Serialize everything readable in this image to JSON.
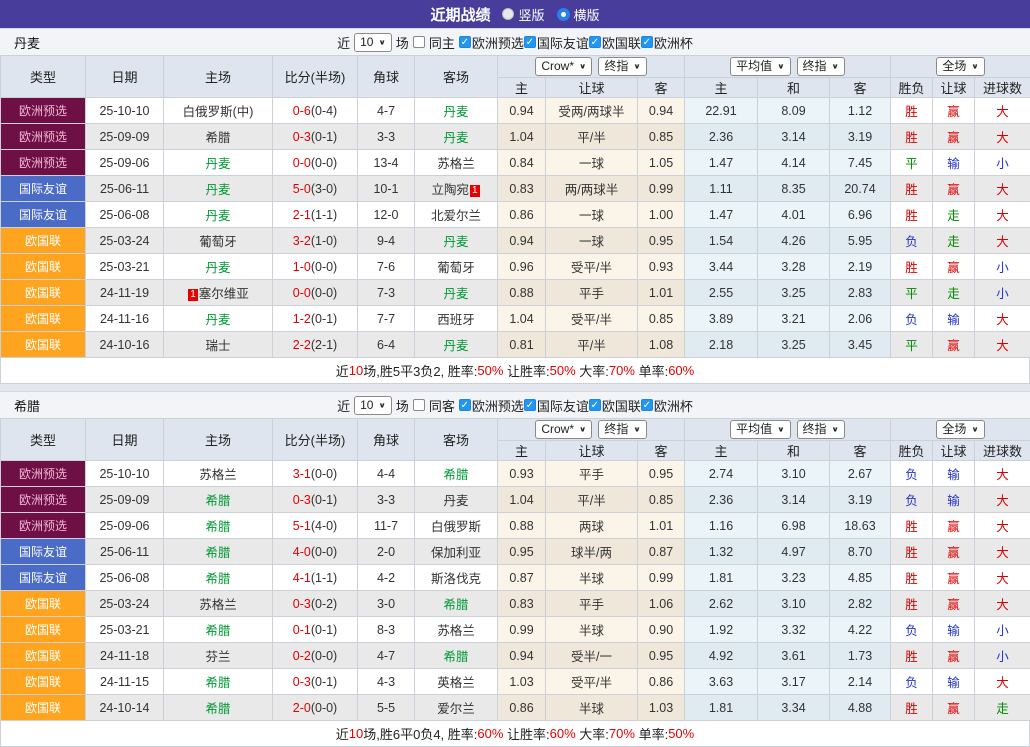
{
  "title_bar": {
    "title": "近期战绩",
    "vertical_label": "竖版",
    "horizontal_label": "横版"
  },
  "filter": {
    "near": "近",
    "count": "10",
    "games": "场"
  },
  "columns": {
    "type": "类型",
    "date": "日期",
    "home": "主场",
    "score": "比分(半场)",
    "corner": "角球",
    "away": "客场",
    "dd_crow": "Crow*",
    "dd_final": "终指",
    "dd_avg": "平均值",
    "dd_full": "全场",
    "h": "主",
    "handicap": "让球",
    "a": "客",
    "avg_h": "主",
    "avg_d": "和",
    "avg_a": "客",
    "wl": "胜负",
    "hc": "让球",
    "goals": "进球数"
  },
  "colors": {
    "accent_purple": "#483d9b",
    "score_red": "#e60000",
    "team_highlight": "#009933",
    "type_badges": {
      "欧洲预选": {
        "bg": "#6e1045",
        "fg": "#f2b7d4"
      },
      "国际友谊": {
        "bg": "#4a6bc6",
        "fg": "#ffffff"
      },
      "欧国联": {
        "bg": "#ffa41f",
        "fg": "#ffffff"
      }
    },
    "outcome": {
      "胜": "#dd0000",
      "平": "#008800",
      "负": "#2233cc",
      "赢": "#dd0000",
      "输": "#2233cc",
      "走": "#008800",
      "大": "#dd0000",
      "小": "#2233cc"
    }
  },
  "sections": [
    {
      "team": "丹麦",
      "same_label": "同主",
      "leagues": [
        "欧洲预选",
        "国际友谊",
        "欧国联",
        "欧洲杯"
      ],
      "rows": [
        {
          "type": "欧洲预选",
          "date": "25-10-10",
          "home": "白俄罗斯(中)",
          "score": "0-6",
          "half": "(0-4)",
          "corner": "4-7",
          "away": "丹麦",
          "odds_h": "0.94",
          "handicap": "受两/两球半",
          "odds_a": "0.94",
          "avg_h": "22.91",
          "avg_d": "8.09",
          "avg_a": "1.12",
          "wl": "胜",
          "hc": "赢",
          "gl": "大"
        },
        {
          "type": "欧洲预选",
          "date": "25-09-09",
          "home": "希腊",
          "score": "0-3",
          "half": "(0-1)",
          "corner": "3-3",
          "away": "丹麦",
          "odds_h": "1.04",
          "handicap": "平/半",
          "odds_a": "0.85",
          "avg_h": "2.36",
          "avg_d": "3.14",
          "avg_a": "3.19",
          "wl": "胜",
          "hc": "赢",
          "gl": "大"
        },
        {
          "type": "欧洲预选",
          "date": "25-09-06",
          "home": "丹麦",
          "score": "0-0",
          "half": "(0-0)",
          "corner": "13-4",
          "away": "苏格兰",
          "odds_h": "0.84",
          "handicap": "一球",
          "odds_a": "1.05",
          "avg_h": "1.47",
          "avg_d": "4.14",
          "avg_a": "7.45",
          "wl": "平",
          "hc": "输",
          "gl": "小"
        },
        {
          "type": "国际友谊",
          "date": "25-06-11",
          "home": "丹麦",
          "score": "5-0",
          "half": "(3-0)",
          "corner": "10-1",
          "away": "立陶宛",
          "away_card": "1",
          "away_card_pos": "after",
          "odds_h": "0.83",
          "handicap": "两/两球半",
          "odds_a": "0.99",
          "avg_h": "1.11",
          "avg_d": "8.35",
          "avg_a": "20.74",
          "wl": "胜",
          "hc": "赢",
          "gl": "大"
        },
        {
          "type": "国际友谊",
          "date": "25-06-08",
          "home": "丹麦",
          "score": "2-1",
          "half": "(1-1)",
          "corner": "12-0",
          "away": "北爱尔兰",
          "odds_h": "0.86",
          "handicap": "一球",
          "odds_a": "1.00",
          "avg_h": "1.47",
          "avg_d": "4.01",
          "avg_a": "6.96",
          "wl": "胜",
          "hc": "走",
          "gl": "大"
        },
        {
          "type": "欧国联",
          "date": "25-03-24",
          "home": "葡萄牙",
          "score": "3-2",
          "half": "(1-0)",
          "corner": "9-4",
          "away": "丹麦",
          "odds_h": "0.94",
          "handicap": "一球",
          "odds_a": "0.95",
          "avg_h": "1.54",
          "avg_d": "4.26",
          "avg_a": "5.95",
          "wl": "负",
          "hc": "走",
          "gl": "大"
        },
        {
          "type": "欧国联",
          "date": "25-03-21",
          "home": "丹麦",
          "score": "1-0",
          "half": "(0-0)",
          "corner": "7-6",
          "away": "葡萄牙",
          "odds_h": "0.96",
          "handicap": "受平/半",
          "odds_a": "0.93",
          "avg_h": "3.44",
          "avg_d": "3.28",
          "avg_a": "2.19",
          "wl": "胜",
          "hc": "赢",
          "gl": "小"
        },
        {
          "type": "欧国联",
          "date": "24-11-19",
          "home": "塞尔维亚",
          "home_card": "1",
          "home_card_pos": "before",
          "score": "0-0",
          "half": "(0-0)",
          "corner": "7-3",
          "away": "丹麦",
          "odds_h": "0.88",
          "handicap": "平手",
          "odds_a": "1.01",
          "avg_h": "2.55",
          "avg_d": "3.25",
          "avg_a": "2.83",
          "wl": "平",
          "hc": "走",
          "gl": "小"
        },
        {
          "type": "欧国联",
          "date": "24-11-16",
          "home": "丹麦",
          "score": "1-2",
          "half": "(0-1)",
          "corner": "7-7",
          "away": "西班牙",
          "odds_h": "1.04",
          "handicap": "受平/半",
          "odds_a": "0.85",
          "avg_h": "3.89",
          "avg_d": "3.21",
          "avg_a": "2.06",
          "wl": "负",
          "hc": "输",
          "gl": "大"
        },
        {
          "type": "欧国联",
          "date": "24-10-16",
          "home": "瑞士",
          "score": "2-2",
          "half": "(2-1)",
          "corner": "6-4",
          "away": "丹麦",
          "odds_h": "0.81",
          "handicap": "平/半",
          "odds_a": "1.08",
          "avg_h": "2.18",
          "avg_d": "3.25",
          "avg_a": "3.45",
          "wl": "平",
          "hc": "赢",
          "gl": "大"
        }
      ],
      "summary": [
        {
          "t": "近"
        },
        {
          "t": "10",
          "red": true
        },
        {
          "t": "场,胜5平3负2, 胜率:"
        },
        {
          "t": "50%",
          "red": true
        },
        {
          "t": " 让胜率:"
        },
        {
          "t": "50%",
          "red": true
        },
        {
          "t": " 大率:"
        },
        {
          "t": "70%",
          "red": true
        },
        {
          "t": " 单率:"
        },
        {
          "t": "60%",
          "red": true
        }
      ]
    },
    {
      "team": "希腊",
      "same_label": "同客",
      "leagues": [
        "欧洲预选",
        "国际友谊",
        "欧国联",
        "欧洲杯"
      ],
      "rows": [
        {
          "type": "欧洲预选",
          "date": "25-10-10",
          "home": "苏格兰",
          "score": "3-1",
          "half": "(0-0)",
          "corner": "4-4",
          "away": "希腊",
          "odds_h": "0.93",
          "handicap": "平手",
          "odds_a": "0.95",
          "avg_h": "2.74",
          "avg_d": "3.10",
          "avg_a": "2.67",
          "wl": "负",
          "hc": "输",
          "gl": "大"
        },
        {
          "type": "欧洲预选",
          "date": "25-09-09",
          "home": "希腊",
          "score": "0-3",
          "half": "(0-1)",
          "corner": "3-3",
          "away": "丹麦",
          "odds_h": "1.04",
          "handicap": "平/半",
          "odds_a": "0.85",
          "avg_h": "2.36",
          "avg_d": "3.14",
          "avg_a": "3.19",
          "wl": "负",
          "hc": "输",
          "gl": "大"
        },
        {
          "type": "欧洲预选",
          "date": "25-09-06",
          "home": "希腊",
          "score": "5-1",
          "half": "(4-0)",
          "corner": "11-7",
          "away": "白俄罗斯",
          "odds_h": "0.88",
          "handicap": "两球",
          "odds_a": "1.01",
          "avg_h": "1.16",
          "avg_d": "6.98",
          "avg_a": "18.63",
          "wl": "胜",
          "hc": "赢",
          "gl": "大"
        },
        {
          "type": "国际友谊",
          "date": "25-06-11",
          "home": "希腊",
          "score": "4-0",
          "half": "(0-0)",
          "corner": "2-0",
          "away": "保加利亚",
          "odds_h": "0.95",
          "handicap": "球半/两",
          "odds_a": "0.87",
          "avg_h": "1.32",
          "avg_d": "4.97",
          "avg_a": "8.70",
          "wl": "胜",
          "hc": "赢",
          "gl": "大"
        },
        {
          "type": "国际友谊",
          "date": "25-06-08",
          "home": "希腊",
          "score": "4-1",
          "half": "(1-1)",
          "corner": "4-2",
          "away": "斯洛伐克",
          "odds_h": "0.87",
          "handicap": "半球",
          "odds_a": "0.99",
          "avg_h": "1.81",
          "avg_d": "3.23",
          "avg_a": "4.85",
          "wl": "胜",
          "hc": "赢",
          "gl": "大"
        },
        {
          "type": "欧国联",
          "date": "25-03-24",
          "home": "苏格兰",
          "score": "0-3",
          "half": "(0-2)",
          "corner": "3-0",
          "away": "希腊",
          "odds_h": "0.83",
          "handicap": "平手",
          "odds_a": "1.06",
          "avg_h": "2.62",
          "avg_d": "3.10",
          "avg_a": "2.82",
          "wl": "胜",
          "hc": "赢",
          "gl": "大"
        },
        {
          "type": "欧国联",
          "date": "25-03-21",
          "home": "希腊",
          "score": "0-1",
          "half": "(0-1)",
          "corner": "8-3",
          "away": "苏格兰",
          "odds_h": "0.99",
          "handicap": "半球",
          "odds_a": "0.90",
          "avg_h": "1.92",
          "avg_d": "3.32",
          "avg_a": "4.22",
          "wl": "负",
          "hc": "输",
          "gl": "小"
        },
        {
          "type": "欧国联",
          "date": "24-11-18",
          "home": "芬兰",
          "score": "0-2",
          "half": "(0-0)",
          "corner": "4-7",
          "away": "希腊",
          "odds_h": "0.94",
          "handicap": "受半/一",
          "odds_a": "0.95",
          "avg_h": "4.92",
          "avg_d": "3.61",
          "avg_a": "1.73",
          "wl": "胜",
          "hc": "赢",
          "gl": "小"
        },
        {
          "type": "欧国联",
          "date": "24-11-15",
          "home": "希腊",
          "score": "0-3",
          "half": "(0-1)",
          "corner": "4-3",
          "away": "英格兰",
          "odds_h": "1.03",
          "handicap": "受平/半",
          "odds_a": "0.86",
          "avg_h": "3.63",
          "avg_d": "3.17",
          "avg_a": "2.14",
          "wl": "负",
          "hc": "输",
          "gl": "大"
        },
        {
          "type": "欧国联",
          "date": "24-10-14",
          "home": "希腊",
          "score": "2-0",
          "half": "(0-0)",
          "corner": "5-5",
          "away": "爱尔兰",
          "odds_h": "0.86",
          "handicap": "半球",
          "odds_a": "1.03",
          "avg_h": "1.81",
          "avg_d": "3.34",
          "avg_a": "4.88",
          "wl": "胜",
          "hc": "赢",
          "gl": "走"
        }
      ],
      "summary": [
        {
          "t": "近"
        },
        {
          "t": "10",
          "red": true
        },
        {
          "t": "场,胜6平0负4, 胜率:"
        },
        {
          "t": "60%",
          "red": true
        },
        {
          "t": " 让胜率:"
        },
        {
          "t": "60%",
          "red": true
        },
        {
          "t": " 大率:"
        },
        {
          "t": "70%",
          "red": true
        },
        {
          "t": " 单率:"
        },
        {
          "t": "50%",
          "red": true
        }
      ]
    }
  ]
}
